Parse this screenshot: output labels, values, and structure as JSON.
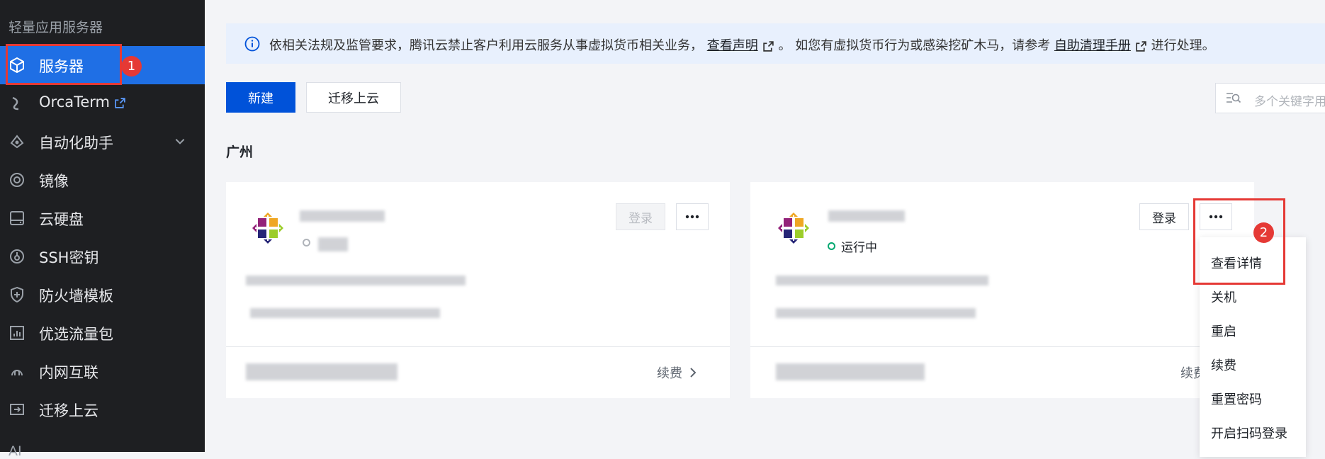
{
  "sidebar": {
    "title": "轻量应用服务器",
    "items": [
      {
        "label": "服务器",
        "icon": "cube-icon"
      },
      {
        "label": "OrcaTerm",
        "icon": "terminal-icon"
      },
      {
        "label": "自动化助手",
        "icon": "automation-icon"
      },
      {
        "label": "镜像",
        "icon": "image-icon"
      },
      {
        "label": "云硬盘",
        "icon": "disk-icon"
      },
      {
        "label": "SSH密钥",
        "icon": "key-icon"
      },
      {
        "label": "防火墙模板",
        "icon": "shield-icon"
      },
      {
        "label": "优选流量包",
        "icon": "traffic-icon"
      },
      {
        "label": "内网互联",
        "icon": "network-icon"
      },
      {
        "label": "迁移上云",
        "icon": "migrate-icon"
      }
    ],
    "bottom_partial": "AI"
  },
  "annotations": {
    "badge1": "1",
    "badge2": "2"
  },
  "notice": {
    "part1": "依相关法规及监管要求，腾讯云禁止客户利用云服务从事虚拟货币相关业务，",
    "link1": "查看声明",
    "part2": "。 如您有虚拟货币行为或感染挖矿木马，请参考",
    "link2": "自助清理手册",
    "part3": "进行处理。"
  },
  "toolbar": {
    "new_label": "新建",
    "migrate_label": "迁移上云",
    "search_placeholder": "多个关键字用"
  },
  "region": "广州",
  "cards": [
    {
      "login": "登录",
      "renew": "续费",
      "status": ""
    },
    {
      "login": "登录",
      "renew": "续费",
      "status": "运行中"
    }
  ],
  "menu": {
    "items": [
      "查看详情",
      "关机",
      "重启",
      "续费",
      "重置密码",
      "开启扫码登录"
    ]
  },
  "colors": {
    "accent": "#0052d9",
    "sidebar_active": "#1f6fe5",
    "highlight": "#e53935",
    "running": "#00a870"
  }
}
